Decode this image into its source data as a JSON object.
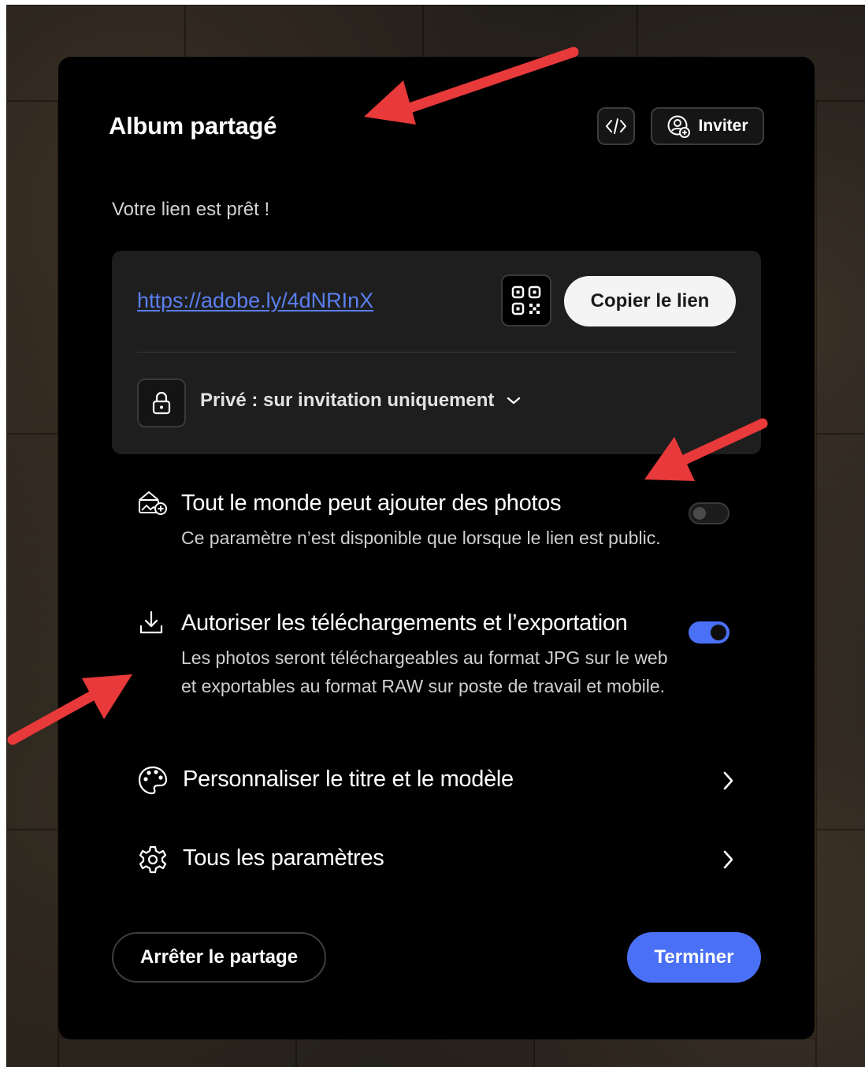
{
  "dialog": {
    "title": "Album partagé",
    "embed_icon": "code-embed-icon",
    "invite": {
      "label": "Inviter",
      "icon": "invite-user-icon"
    }
  },
  "share": {
    "ready_text": "Votre lien est prêt !",
    "link_url": "https://adobe.ly/4dNRInX",
    "qr_icon": "qr-code-icon",
    "copy_label": "Copier le lien",
    "access": {
      "icon": "lock-icon",
      "label": "Privé : sur invitation uniquement"
    }
  },
  "settings": {
    "add_photos": {
      "title": "Tout le monde peut ajouter des photos",
      "description": "Ce paramètre n’est disponible que lorsque le lien est public.",
      "enabled": false
    },
    "downloads": {
      "title": "Autoriser les téléchargements et l’exportation",
      "description": "Les photos seront téléchargeables au format JPG sur le web et exportables au format RAW sur poste de travail et mobile.",
      "enabled": true
    },
    "customize": {
      "label": "Personnaliser le titre et le modèle",
      "icon": "palette-icon"
    },
    "all_settings": {
      "label": "Tous les paramètres",
      "icon": "gear-icon"
    }
  },
  "footer": {
    "stop_label": "Arrêter le partage",
    "done_label": "Terminer"
  },
  "colors": {
    "accent": "#4a70f5",
    "link": "#5a7ff0",
    "dialog_bg": "#000000",
    "card_bg": "#1e1e1e",
    "annotation_arrow": "#e8393b"
  }
}
